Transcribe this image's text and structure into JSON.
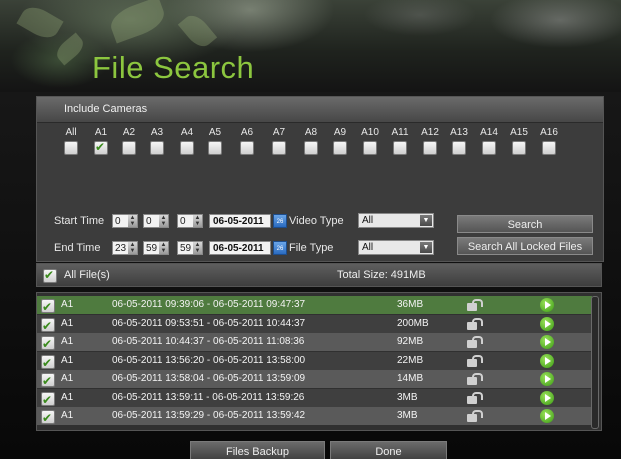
{
  "title": "File Search",
  "cameras": {
    "header": "Include Cameras",
    "items": [
      {
        "label": "All",
        "checked": false
      },
      {
        "label": "A1",
        "checked": true
      },
      {
        "label": "A2",
        "checked": false
      },
      {
        "label": "A3",
        "checked": false
      },
      {
        "label": "A4",
        "checked": false
      },
      {
        "label": "A5",
        "checked": false
      },
      {
        "label": "A6",
        "checked": false
      },
      {
        "label": "A7",
        "checked": false
      },
      {
        "label": "A8",
        "checked": false
      },
      {
        "label": "A9",
        "checked": false
      },
      {
        "label": "A10",
        "checked": false
      },
      {
        "label": "A11",
        "checked": false
      },
      {
        "label": "A12",
        "checked": false
      },
      {
        "label": "A13",
        "checked": false
      },
      {
        "label": "A14",
        "checked": false
      },
      {
        "label": "A15",
        "checked": false
      },
      {
        "label": "A16",
        "checked": false
      }
    ]
  },
  "start_time": {
    "label": "Start Time",
    "hour": "0",
    "minute": "0",
    "second": "0",
    "date": "06-05-2011"
  },
  "end_time": {
    "label": "End Time",
    "hour": "23",
    "minute": "59",
    "second": "59",
    "date": "06-05-2011"
  },
  "video_type": {
    "label": "Video Type",
    "value": "All"
  },
  "file_type": {
    "label": "File Type",
    "value": "All"
  },
  "buttons": {
    "search": "Search",
    "search_locked": "Search All Locked Files",
    "files_backup": "Files Backup",
    "done": "Done"
  },
  "list_header": {
    "all_files": "All File(s)",
    "total_size": "Total Size: 491MB",
    "all_checked": true
  },
  "files": [
    {
      "camera": "A1",
      "range": "06-05-2011 09:39:06 - 06-05-2011 09:47:37",
      "size": "36MB",
      "checked": true,
      "selected": true
    },
    {
      "camera": "A1",
      "range": "06-05-2011 09:53:51 - 06-05-2011 10:44:37",
      "size": "200MB",
      "checked": true,
      "selected": false
    },
    {
      "camera": "A1",
      "range": "06-05-2011 10:44:37 - 06-05-2011 11:08:36",
      "size": "92MB",
      "checked": true,
      "selected": false
    },
    {
      "camera": "A1",
      "range": "06-05-2011 13:56:20 - 06-05-2011 13:58:00",
      "size": "22MB",
      "checked": true,
      "selected": false
    },
    {
      "camera": "A1",
      "range": "06-05-2011 13:58:04 - 06-05-2011 13:59:09",
      "size": "14MB",
      "checked": true,
      "selected": false
    },
    {
      "camera": "A1",
      "range": "06-05-2011 13:59:11 - 06-05-2011 13:59:26",
      "size": "3MB",
      "checked": true,
      "selected": false
    },
    {
      "camera": "A1",
      "range": "06-05-2011 13:59:29 - 06-05-2011 13:59:42",
      "size": "3MB",
      "checked": true,
      "selected": false
    }
  ],
  "colors": {
    "accent_green": "#8cc63f",
    "row_selected": "#4f7b3f",
    "row_alt_a": "#5a5a5a",
    "row_alt_b": "#3f3f3f"
  }
}
